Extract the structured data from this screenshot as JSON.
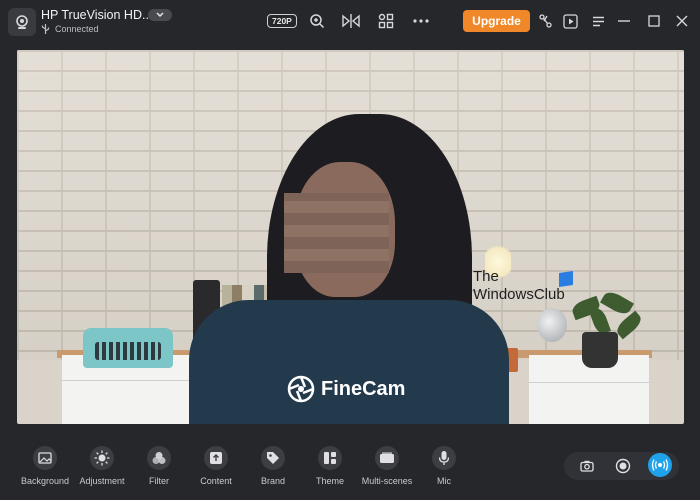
{
  "header": {
    "device_name": "HP TrueVision HD...",
    "status": "Connected",
    "resolution_badge": "720P",
    "upgrade_label": "Upgrade"
  },
  "preview": {
    "watermark_line1": "The",
    "watermark_line2": "WindowsClub",
    "brand_label": "FineCam"
  },
  "toolbar": {
    "items": [
      {
        "label": "Background",
        "icon": "image-icon"
      },
      {
        "label": "Adjustment",
        "icon": "brightness-icon"
      },
      {
        "label": "Filter",
        "icon": "filter-icon"
      },
      {
        "label": "Content",
        "icon": "upload-icon"
      },
      {
        "label": "Brand",
        "icon": "tag-icon"
      },
      {
        "label": "Theme",
        "icon": "layout-icon"
      },
      {
        "label": "Multi-scenes",
        "icon": "scenes-icon"
      },
      {
        "label": "Mic",
        "icon": "mic-icon"
      }
    ]
  },
  "colors": {
    "background": "#26272b",
    "accent": "#f0882a",
    "live": "#1fa2ea"
  }
}
